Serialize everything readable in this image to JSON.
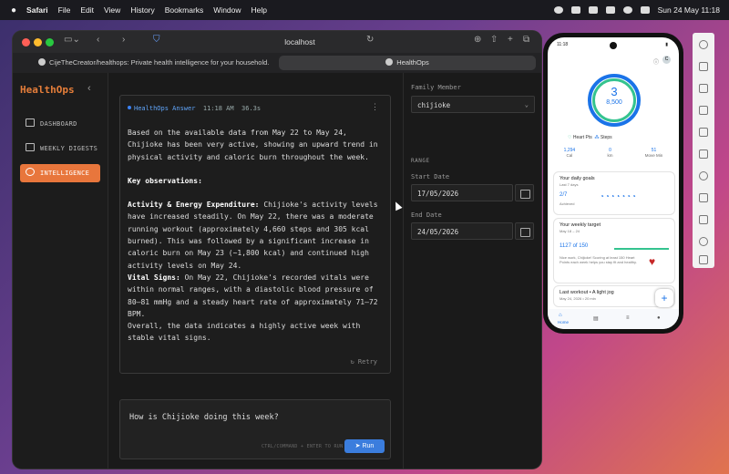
{
  "menubar": {
    "app": "Safari",
    "items": [
      "File",
      "Edit",
      "View",
      "History",
      "Bookmarks",
      "Window",
      "Help"
    ],
    "clock": "Sun 24 May  11:18"
  },
  "browser": {
    "url": "localhost",
    "tab1": "CijeTheCreator/healthops: Private health intelligence for your household.",
    "tab2": "HealthOps"
  },
  "sidebar": {
    "title": "HealthOps",
    "items": [
      {
        "label": "DASHBOARD"
      },
      {
        "label": "WEEKLY DIGESTS"
      },
      {
        "label": "INTELLIGENCE"
      }
    ]
  },
  "answer": {
    "label": "HealthOps Answer",
    "time": "11:18 AM",
    "duration": "36.3s",
    "p1": "Based on the available data from May 22 to May 24, Chijioke has been very active, showing an upward trend in physical activity and caloric burn throughout the week.",
    "h1": "Key observations:",
    "b1_title": "Activity & Energy Expenditure:",
    "b1_text": " Chijioke's activity levels have increased steadily. On May 22, there was a moderate running workout (approximately 4,660 steps and 305 kcal burned). This was followed by a significant increase in caloric burn on May 23 (~1,800 kcal) and continued high activity levels on May 24.",
    "b2_title": "Vital Signs:",
    "b2_text": " On May 22, Chijioke's recorded vitals were within normal ranges, with a diastolic blood pressure of 80–81 mmHg and a steady heart rate of approximately 71–72 BPM.",
    "p_end": "Overall, the data indicates a highly active week with stable vital signs.",
    "retry": "Retry"
  },
  "composer": {
    "prompt": "How is Chijioke doing this week?",
    "hint": "CTRL/COMMAND + ENTER TO RUN",
    "run": "Run"
  },
  "filters": {
    "member_label": "Family Member",
    "member_value": "chijioke",
    "range_label": "RANGE",
    "start_label": "Start Date",
    "start_value": "17/05/2026",
    "end_label": "End Date",
    "end_value": "24/05/2026"
  },
  "phone": {
    "time": "11:18",
    "ring_main": "3",
    "ring_sub": "8,500",
    "legend_heart": "Heart Pts",
    "legend_steps": "Steps",
    "stats": [
      {
        "value": "1,294",
        "label": "Cal"
      },
      {
        "value": "0",
        "label": "km"
      },
      {
        "value": "51",
        "label": "Move Min"
      }
    ],
    "goals_title": "Your daily goals",
    "goals_sub": "Last 7 days",
    "goals_value": "2/7",
    "goals_status": "Achieved",
    "target_title": "Your weekly target",
    "target_sub": "May 18 – 24",
    "target_value": "1127 of 150",
    "target_text": "Nice work, Chijioke! Scoring at least 150 Heart Points each week helps you stay fit and healthy.",
    "workout_title": "Last workout • A light jog",
    "workout_sub": "May 24, 2026 • 20 min",
    "nav_home": "Home"
  }
}
